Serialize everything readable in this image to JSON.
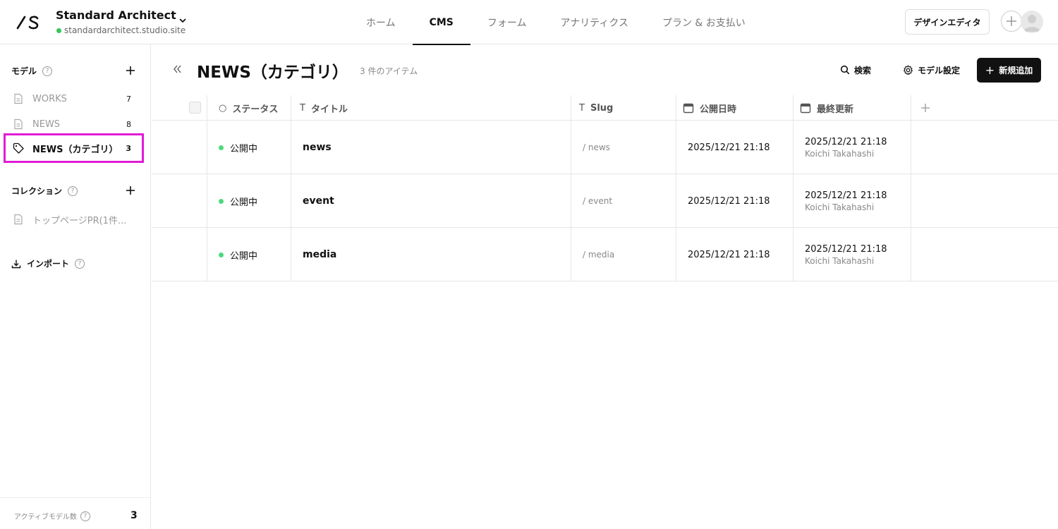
{
  "header": {
    "site_name": "Standard Architect",
    "site_url": "standardarchitect.studio.site",
    "nav": [
      {
        "label": "ホーム",
        "active": false
      },
      {
        "label": "CMS",
        "active": true
      },
      {
        "label": "フォーム",
        "active": false
      },
      {
        "label": "アナリティクス",
        "active": false
      },
      {
        "label": "プラン & お支払い",
        "active": false
      }
    ],
    "design_editor_label": "デザインエディタ"
  },
  "sidebar": {
    "models_label": "モデル",
    "models": [
      {
        "label": "WORKS",
        "count": "7",
        "icon": "document-icon"
      },
      {
        "label": "NEWS",
        "count": "8",
        "icon": "document-icon"
      },
      {
        "label": "NEWS（カテゴリ）",
        "count": "3",
        "icon": "tag-icon",
        "selected": true
      }
    ],
    "collections_label": "コレクション",
    "collections": [
      {
        "label": "トップページPR(1件...",
        "icon": "document-icon"
      }
    ],
    "import_label": "インポート",
    "active_models_label": "アクティブモデル数",
    "active_models_count": "3"
  },
  "main": {
    "title": "NEWS（カテゴリ）",
    "item_count": "3 件のアイテム",
    "search_label": "検索",
    "model_settings_label": "モデル設定",
    "new_item_label": "新規追加",
    "columns": {
      "status": "ステータス",
      "title": "タイトル",
      "slug": "Slug",
      "published": "公開日時",
      "updated": "最終更新"
    },
    "rows": [
      {
        "status": "公開中",
        "title": "news",
        "slug": "/ news",
        "published": "2025/12/21 21:18",
        "updated": "2025/12/21 21:18",
        "updated_by": "Koichi Takahashi"
      },
      {
        "status": "公開中",
        "title": "event",
        "slug": "/ event",
        "published": "2025/12/21 21:18",
        "updated": "2025/12/21 21:18",
        "updated_by": "Koichi Takahashi"
      },
      {
        "status": "公開中",
        "title": "media",
        "slug": "/ media",
        "published": "2025/12/21 21:18",
        "updated": "2025/12/21 21:18",
        "updated_by": "Koichi Takahashi"
      }
    ]
  },
  "colors": {
    "accent": "#111111",
    "status_published": "#4cd97b",
    "site_online": "#34c759",
    "highlight": "#e21bd6"
  }
}
